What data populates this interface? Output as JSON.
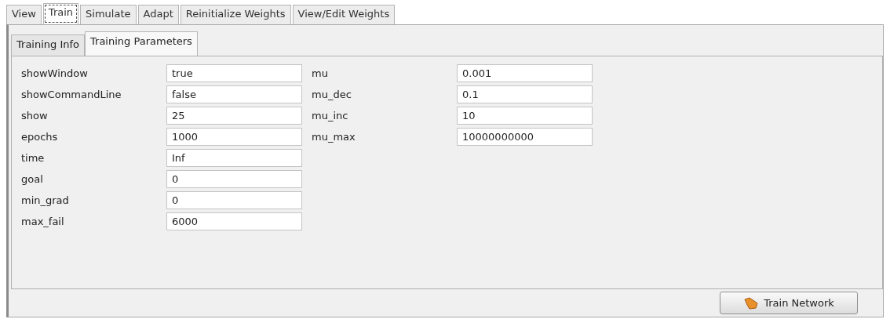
{
  "tabs": [
    {
      "label": "View",
      "selected": false
    },
    {
      "label": "Train",
      "selected": true
    },
    {
      "label": "Simulate",
      "selected": false
    },
    {
      "label": "Adapt",
      "selected": false
    },
    {
      "label": "Reinitialize Weights",
      "selected": false
    },
    {
      "label": "View/Edit Weights",
      "selected": false
    }
  ],
  "subtabs": [
    {
      "label": "Training Info",
      "selected": false
    },
    {
      "label": "Training Parameters",
      "selected": true
    }
  ],
  "parameter_columns": [
    [
      {
        "name": "showWindow",
        "value": "true"
      },
      {
        "name": "showCommandLine",
        "value": "false"
      },
      {
        "name": "show",
        "value": "25"
      },
      {
        "name": "epochs",
        "value": "1000"
      },
      {
        "name": "time",
        "value": "Inf"
      },
      {
        "name": "goal",
        "value": "0"
      },
      {
        "name": "min_grad",
        "value": "0"
      },
      {
        "name": "max_fail",
        "value": "6000"
      }
    ],
    [
      {
        "name": "mu",
        "value": "0.001"
      },
      {
        "name": "mu_dec",
        "value": "0.1"
      },
      {
        "name": "mu_inc",
        "value": "10"
      },
      {
        "name": "mu_max",
        "value": "10000000000"
      }
    ]
  ],
  "button": {
    "label": "Train Network"
  }
}
